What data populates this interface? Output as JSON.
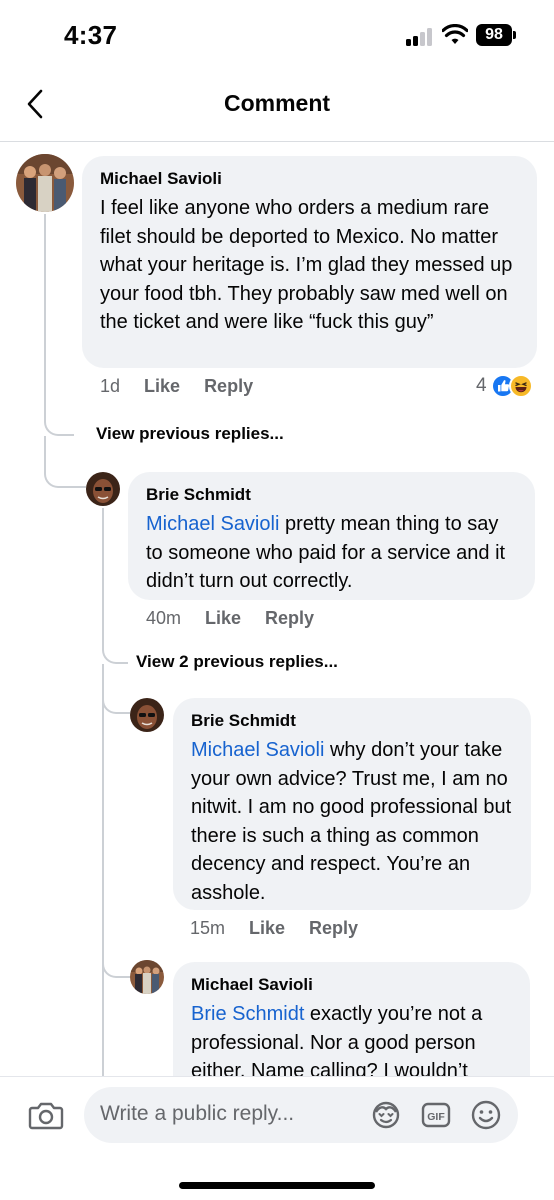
{
  "status_bar": {
    "time": "4:37",
    "battery": "98"
  },
  "header": {
    "title": "Comment"
  },
  "comments": [
    {
      "author": "Michael Savioli",
      "mention": "",
      "text": "I feel like anyone who orders a medium rare filet should be deported to Mexico. No matter what your heritage is. I’m glad they messed up your food tbh. They probably saw med well on the ticket and were like “fuck this guy”",
      "time": "1d",
      "like_label": "Like",
      "reply_label": "Reply",
      "reaction_count": "4",
      "reactions": [
        "like-reaction-icon",
        "haha-reaction-icon"
      ]
    },
    {
      "author": "Brie Schmidt",
      "mention": "Michael Savioli",
      "text": " pretty mean thing to say to someone who paid for a service and it didn’t turn out correctly.",
      "time": "40m",
      "like_label": "Like",
      "reply_label": "Reply"
    },
    {
      "author": "Brie Schmidt",
      "mention": "Michael Savioli",
      "text": " why don’t your take your own advice? Trust me, I am no nitwit. I am no good professional but there is such a thing as common decency and respect. You’re an asshole.",
      "time": "15m",
      "like_label": "Like",
      "reply_label": "Reply"
    },
    {
      "author": "Michael Savioli",
      "mention": "Brie Schmidt",
      "text": " exactly you’re not a professional. Nor a good person either. Name calling? I wouldn’t"
    }
  ],
  "view_previous": {
    "first": "View previous replies...",
    "second": "View 2 previous replies..."
  },
  "composer": {
    "placeholder": "Write a public reply...",
    "icons": [
      "camera-icon",
      "avatar-sticker-icon",
      "gif-icon",
      "emoji-icon"
    ]
  },
  "colors": {
    "mention": "#1763cf",
    "bubble": "#f0f2f5",
    "like_blue": "#1877f2",
    "haha_yellow": "#f7b928"
  }
}
